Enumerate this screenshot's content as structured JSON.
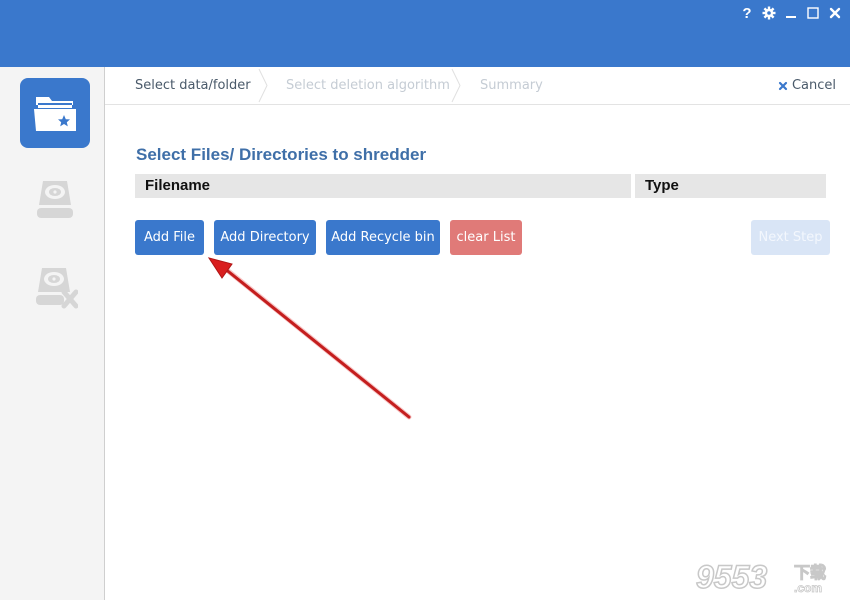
{
  "window": {
    "controls": [
      {
        "name": "help",
        "icon": "question-icon"
      },
      {
        "name": "settings",
        "icon": "gear-icon"
      },
      {
        "name": "minimize",
        "icon": "minimize-icon"
      },
      {
        "name": "maximize",
        "icon": "maximize-icon"
      },
      {
        "name": "close",
        "icon": "close-icon"
      }
    ],
    "help_glyph": "?"
  },
  "sidebar": {
    "items": [
      {
        "name": "select-data",
        "icon": "folder-star-icon",
        "active": true
      },
      {
        "name": "deletion-algorithm",
        "icon": "hard-drive-icon",
        "active": false
      },
      {
        "name": "summary",
        "icon": "hard-drive-delete-icon",
        "active": false
      }
    ]
  },
  "steps": [
    {
      "label": "Select data/folder",
      "state": "current"
    },
    {
      "label": "Select deletion algorithm",
      "state": "future"
    },
    {
      "label": "Summary",
      "state": "future"
    }
  ],
  "cancel": {
    "label": "Cancel",
    "icon": "close-icon"
  },
  "main": {
    "title": "Select Files/ Directories to shredder",
    "columns": [
      "Filename",
      "Type"
    ],
    "rows": []
  },
  "buttons": {
    "add_file": "Add File",
    "add_directory": "Add Directory",
    "add_recycle_bin": "Add Recycle bin",
    "clear_list": "clear List",
    "next_step": "Next Step"
  },
  "annotation": {
    "type": "arrow",
    "color": "#cc1f1f",
    "points_to": "add-file-button"
  },
  "colors": {
    "accent": "#3a78cc",
    "danger": "#e07a78",
    "title": "#3f6fa8"
  },
  "watermark": {
    "text": "9553",
    "suffix": "下载",
    "domain": ".com"
  }
}
